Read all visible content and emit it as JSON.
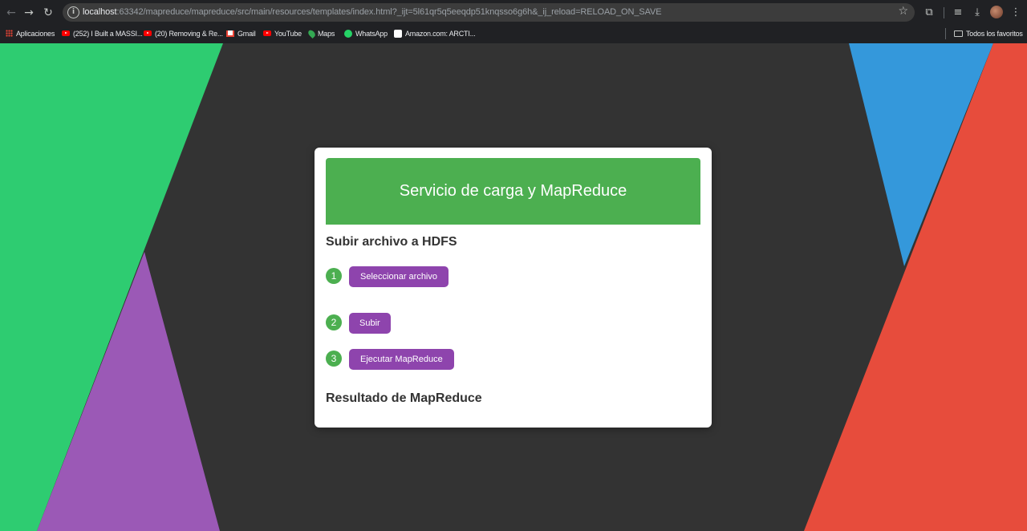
{
  "browser": {
    "url_host": "localhost",
    "url_rest": ":63342/mapreduce/mapreduce/src/main/resources/templates/index.html?_ijt=5l61qr5q5eeqdp51knqsso6g6h&_ij_reload=RELOAD_ON_SAVE",
    "bookmarks": [
      {
        "label": "Aplicaciones",
        "icon": "apps-grid-icon"
      },
      {
        "label": "(252) I Built a MASSI...",
        "icon": "youtube-icon"
      },
      {
        "label": "(20) Removing & Re...",
        "icon": "youtube-icon"
      },
      {
        "label": "Gmail",
        "icon": "gmail-icon"
      },
      {
        "label": "YouTube",
        "icon": "youtube-icon"
      },
      {
        "label": "Maps",
        "icon": "maps-icon"
      },
      {
        "label": "WhatsApp",
        "icon": "whatsapp-icon"
      },
      {
        "label": "Amazon.com: ARCTI...",
        "icon": "amazon-icon"
      }
    ],
    "all_bookmarks_label": "Todos los favoritos"
  },
  "app": {
    "banner_title": "Servicio de carga y MapReduce",
    "upload_section_title": "Subir archivo a HDFS",
    "steps": [
      {
        "number": "1",
        "button": "Seleccionar archivo"
      },
      {
        "number": "2",
        "button": "Subir"
      },
      {
        "number": "3",
        "button": "Ejecutar MapReduce"
      }
    ],
    "result_section_title": "Resultado de MapReduce"
  },
  "colors": {
    "page_background": "#333333",
    "banner": "#4caf50",
    "step_badge": "#4caf50",
    "button": "#8e44ad",
    "shape_green": "#2ecc71",
    "shape_purple": "#9b59b6",
    "shape_blue": "#3498db",
    "shape_red": "#e74c3c"
  }
}
